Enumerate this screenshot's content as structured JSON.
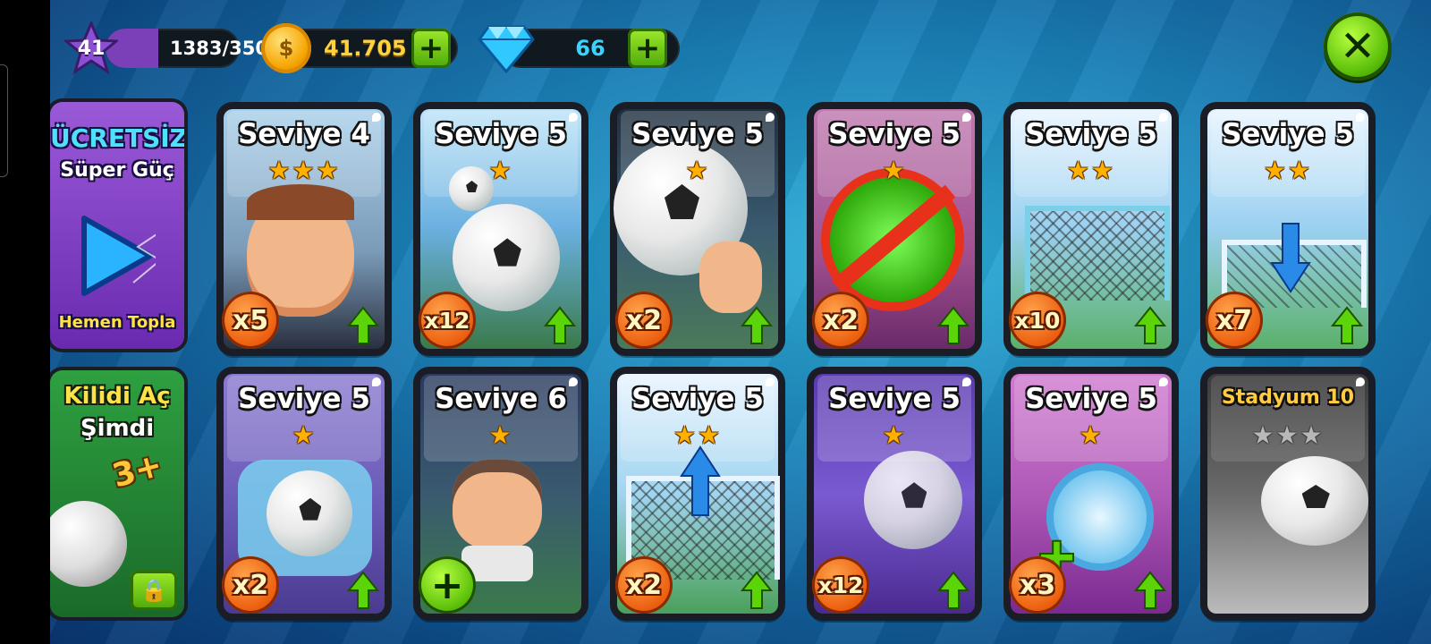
{
  "hud": {
    "level": "41",
    "xp": "1383/3500",
    "xp_progress": 0.395,
    "coins": "41.705",
    "gems": "66"
  },
  "special_cards": [
    {
      "line1": "ÜCRETSİZ",
      "line2": "Süper Güç",
      "line3": "Hemen Topla"
    },
    {
      "line1": "Kilidi Aç",
      "line2": "Şimdi",
      "badge": "3+"
    }
  ],
  "cards_row1": [
    {
      "title": "Seviye 4",
      "stars": "★★★",
      "mult": "x5"
    },
    {
      "title": "Seviye 5",
      "stars": "★",
      "mult": "x12"
    },
    {
      "title": "Seviye 5",
      "stars": "★",
      "mult": "x2"
    },
    {
      "title": "Seviye 5",
      "stars": "★",
      "mult": "x2"
    },
    {
      "title": "Seviye 5",
      "stars": "★★",
      "mult": "x10"
    },
    {
      "title": "Seviye 5",
      "stars": "★★",
      "mult": "x7"
    }
  ],
  "cards_row2": [
    {
      "title": "Seviye 5",
      "stars": "★",
      "mult": "x2"
    },
    {
      "title": "Seviye 6",
      "stars": "★",
      "mult": "+"
    },
    {
      "title": "Seviye 5",
      "stars": "★★",
      "mult": "x2"
    },
    {
      "title": "Seviye 5",
      "stars": "★",
      "mult": "x12"
    },
    {
      "title": "Seviye 5",
      "stars": "★",
      "mult": "x3"
    },
    {
      "title": "Stadyum 10",
      "stars": "★★★",
      "mult": ""
    }
  ],
  "colors": {
    "accent_green": "#5cc00a",
    "coin": "#ffd23d",
    "gem": "#3ad3ff",
    "xp_bar": "#7b3fb8"
  }
}
